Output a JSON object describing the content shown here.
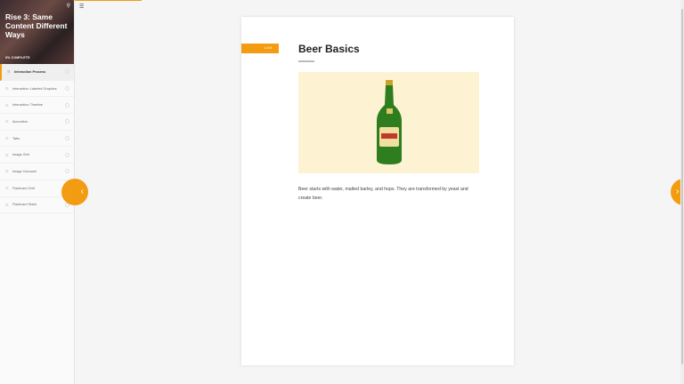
{
  "course": {
    "title": "Rise 3: Same Content Different Ways",
    "progress": "0% COMPLETE"
  },
  "lessons": [
    {
      "label": "Interaction Process",
      "active": true
    },
    {
      "label": "Interaction: Labeled Graphics"
    },
    {
      "label": "Interaction: Timeline"
    },
    {
      "label": "Accordion"
    },
    {
      "label": "Tabs"
    },
    {
      "label": "Image Grid"
    },
    {
      "label": "Image Carousel"
    },
    {
      "label": "Flashcard Grid"
    },
    {
      "label": "Flashcard Stack"
    }
  ],
  "lesson": {
    "counter": "1 of 8",
    "title": "Beer Basics",
    "body": "Beer starts with water, malted barley, and hops. They are transformed by yeast and create beer."
  },
  "colors": {
    "accent": "#f39c12"
  }
}
